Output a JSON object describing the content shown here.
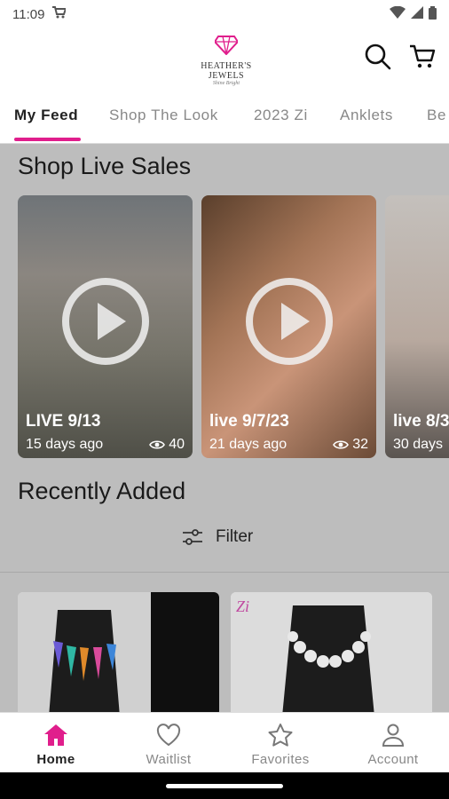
{
  "status_bar": {
    "time": "11:09"
  },
  "header": {
    "brand": "HEATHER'S JEWELS",
    "tagline": "Shine Bright",
    "brand_color": "#e01e8c"
  },
  "tabs": [
    {
      "label": "My Feed",
      "active": true
    },
    {
      "label": "Shop The Look",
      "active": false
    },
    {
      "label": "2023 Zi",
      "active": false
    },
    {
      "label": "Anklets",
      "active": false
    },
    {
      "label": "Be",
      "active": false
    }
  ],
  "live_sales": {
    "title": "Shop Live Sales",
    "cards": [
      {
        "title": "LIVE 9/13",
        "ago": "15 days ago",
        "views": "40"
      },
      {
        "title": "live 9/7/23",
        "ago": "21 days ago",
        "views": "32"
      },
      {
        "title": "live 8/3",
        "ago": "30 days",
        "views": ""
      }
    ]
  },
  "recently_added": {
    "title": "Recently Added",
    "filter_label": "Filter"
  },
  "bottom_nav": [
    {
      "label": "Home",
      "icon": "home-icon",
      "active": true
    },
    {
      "label": "Waitlist",
      "icon": "heart-icon",
      "active": false
    },
    {
      "label": "Favorites",
      "icon": "star-icon",
      "active": false
    },
    {
      "label": "Account",
      "icon": "account-icon",
      "active": false
    }
  ]
}
